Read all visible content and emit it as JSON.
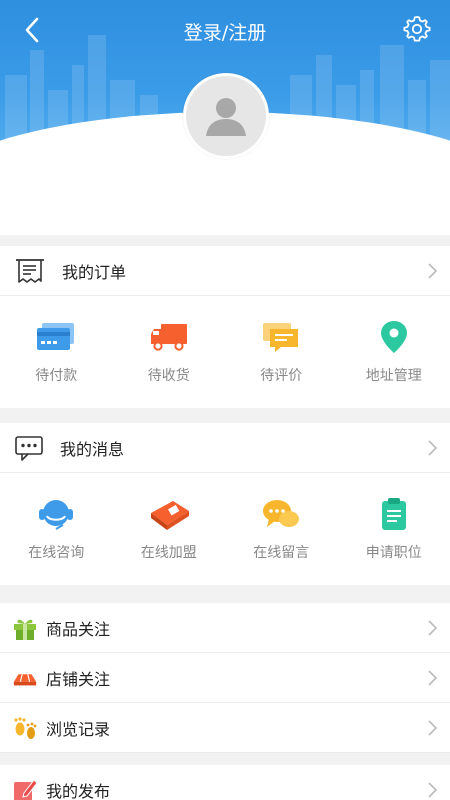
{
  "header": {
    "title": "登录/注册"
  },
  "orders": {
    "label": "我的订单",
    "items": [
      {
        "label": "待付款",
        "icon": "card-icon",
        "color": "#3d9be9"
      },
      {
        "label": "待收货",
        "icon": "truck-icon",
        "color": "#f5602e"
      },
      {
        "label": "待评价",
        "icon": "comment-icon",
        "color": "#f7b62c"
      },
      {
        "label": "地址管理",
        "icon": "location-pin-icon",
        "color": "#2cc9a0"
      }
    ]
  },
  "messages": {
    "label": "我的消息",
    "items": [
      {
        "label": "在线咨询",
        "icon": "headset-icon",
        "color": "#3d9be9"
      },
      {
        "label": "在线加盟",
        "icon": "join-box-icon",
        "color": "#f5602e"
      },
      {
        "label": "在线留言",
        "icon": "chat-bubbles-icon",
        "color": "#f7b62c"
      },
      {
        "label": "申请职位",
        "icon": "clipboard-icon",
        "color": "#2cc9a0"
      }
    ]
  },
  "list": [
    {
      "label": "商品关注",
      "icon": "gift-icon"
    },
    {
      "label": "店铺关注",
      "icon": "shop-awning-icon"
    },
    {
      "label": "浏览记录",
      "icon": "footprints-icon"
    }
  ],
  "publish": {
    "label": "我的发布",
    "icon": "pen-icon"
  }
}
